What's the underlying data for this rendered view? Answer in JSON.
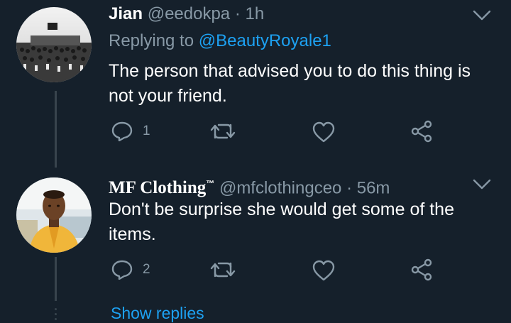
{
  "tweets": [
    {
      "name": "Jian",
      "handle": "@eedokpa",
      "time": "· 1h",
      "replying_label": "Replying to",
      "replying_handle": "@BeautyRoyale1",
      "text": "The person that advised you to do this thing is not your friend.",
      "reply_count": "1",
      "avatar": "crowd-photo"
    },
    {
      "name": "MF Clothing",
      "name_badge": "™",
      "handle": "@mfclothingceo",
      "time": "· 56m",
      "text": "Don't be surprise she would get some of the items.",
      "reply_count": "2",
      "avatar": "man-in-yellow-photo"
    }
  ],
  "show_replies_label": "Show replies",
  "icons": [
    "chevron-down-icon",
    "reply-icon",
    "retweet-icon",
    "like-icon",
    "share-icon"
  ],
  "colors": {
    "background": "#15202b",
    "text": "#ffffff",
    "muted": "#8899a6",
    "link": "#1da1f2",
    "thread_line": "#38444d"
  }
}
